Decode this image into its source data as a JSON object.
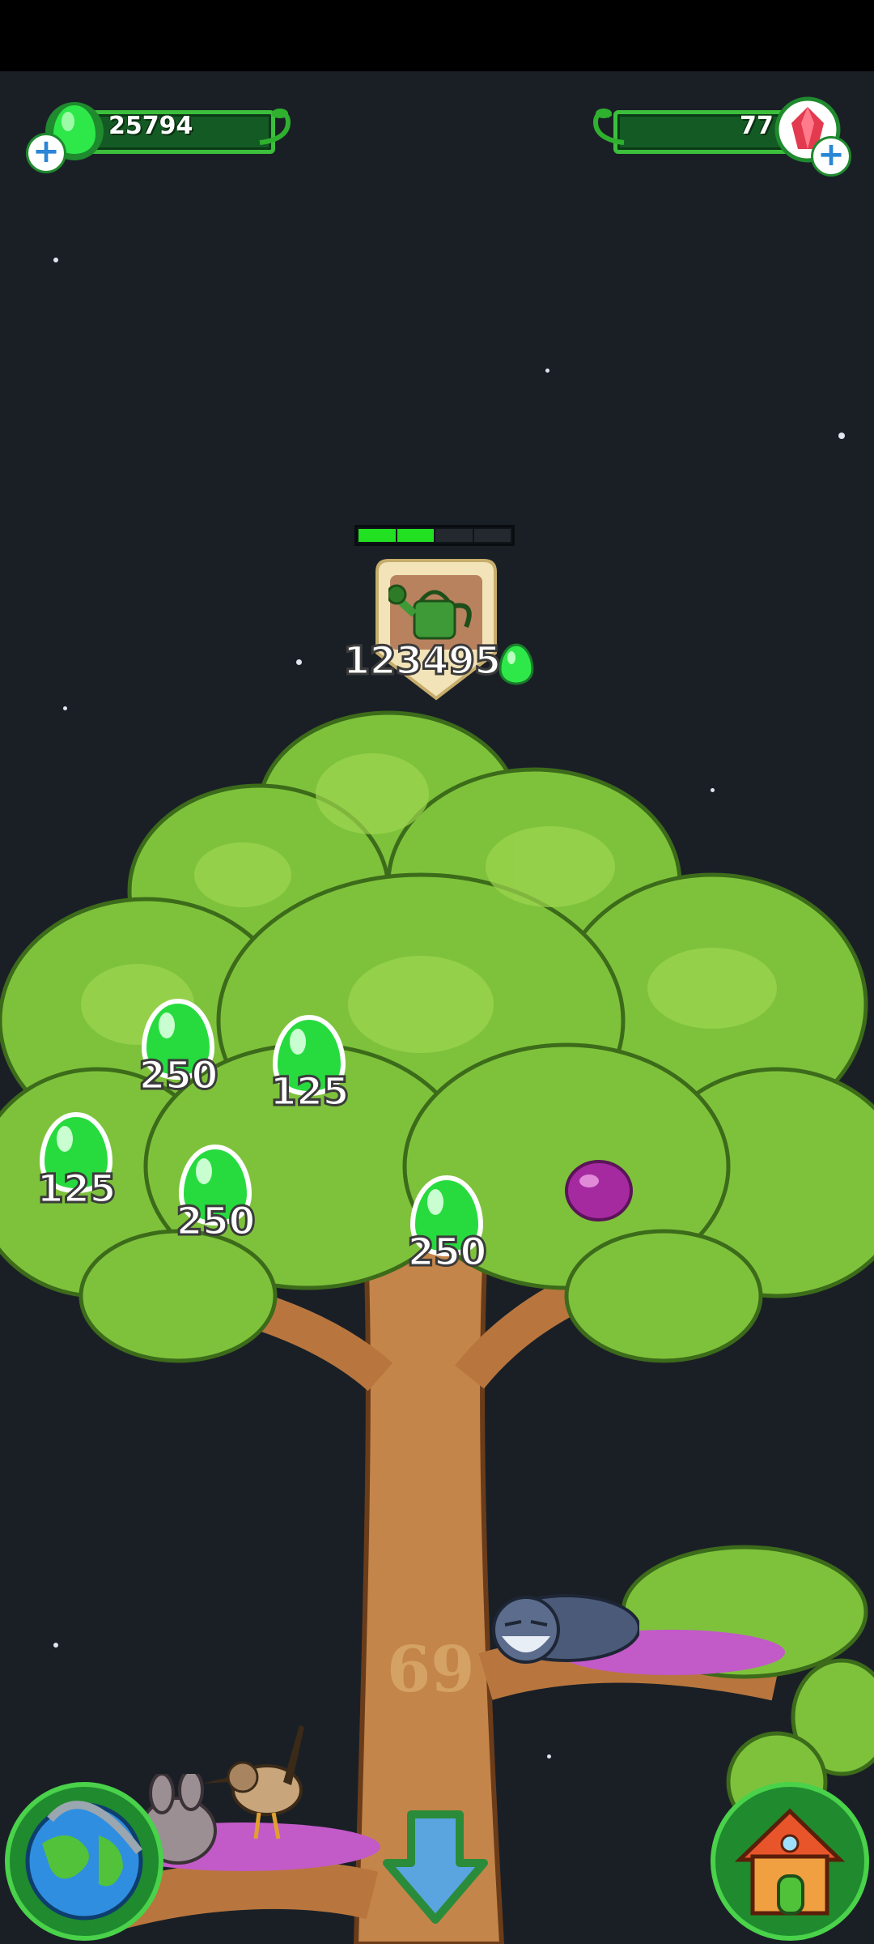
{
  "hud": {
    "drops_count": "25794",
    "gems_count": "77"
  },
  "task": {
    "icon": "watering-can-icon",
    "cost": "123495",
    "progress": 0.4
  },
  "drops": [
    {
      "value": "250"
    },
    {
      "value": "125"
    },
    {
      "value": "125"
    },
    {
      "value": "250"
    },
    {
      "value": "250"
    }
  ],
  "tree": {
    "level": "69"
  },
  "colors": {
    "drop_green": "#22d63a",
    "gem_red": "#e23a4f",
    "sky": "#1a1f26"
  }
}
